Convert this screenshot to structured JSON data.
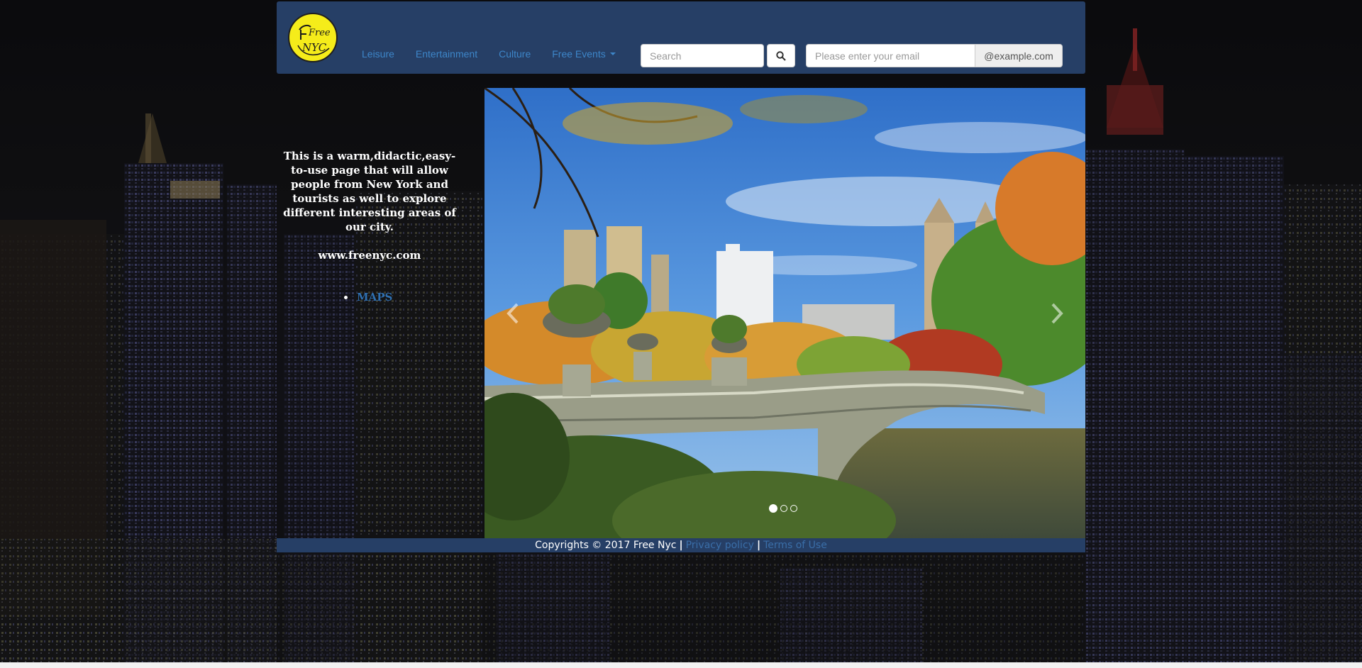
{
  "logo": {
    "line1": "Free",
    "line2": "NYC"
  },
  "nav": {
    "links": [
      {
        "label": "Leisure"
      },
      {
        "label": "Entertainment"
      },
      {
        "label": "Culture"
      },
      {
        "label": "Free Events"
      }
    ]
  },
  "search": {
    "placeholder": "Search"
  },
  "email": {
    "placeholder": "Please enter your email",
    "addon": "@example.com"
  },
  "intro": {
    "text": "This is a warm,didactic,easy-to-use page that will allow people from New York and tourists as well to explore different interesting areas of our city.",
    "url": "www.freenyc.com",
    "maps_link": "MAPS"
  },
  "carousel": {
    "slide_count": 3,
    "active_index": 0
  },
  "footer": {
    "copyright": "Copyrights © 2017 Free Nyc",
    "privacy": "Privacy policy",
    "terms": "Terms of Use",
    "separator": "|"
  },
  "colors": {
    "navbar": "#263f66",
    "link": "#3d86c9",
    "logo": "#f5ec1a"
  }
}
